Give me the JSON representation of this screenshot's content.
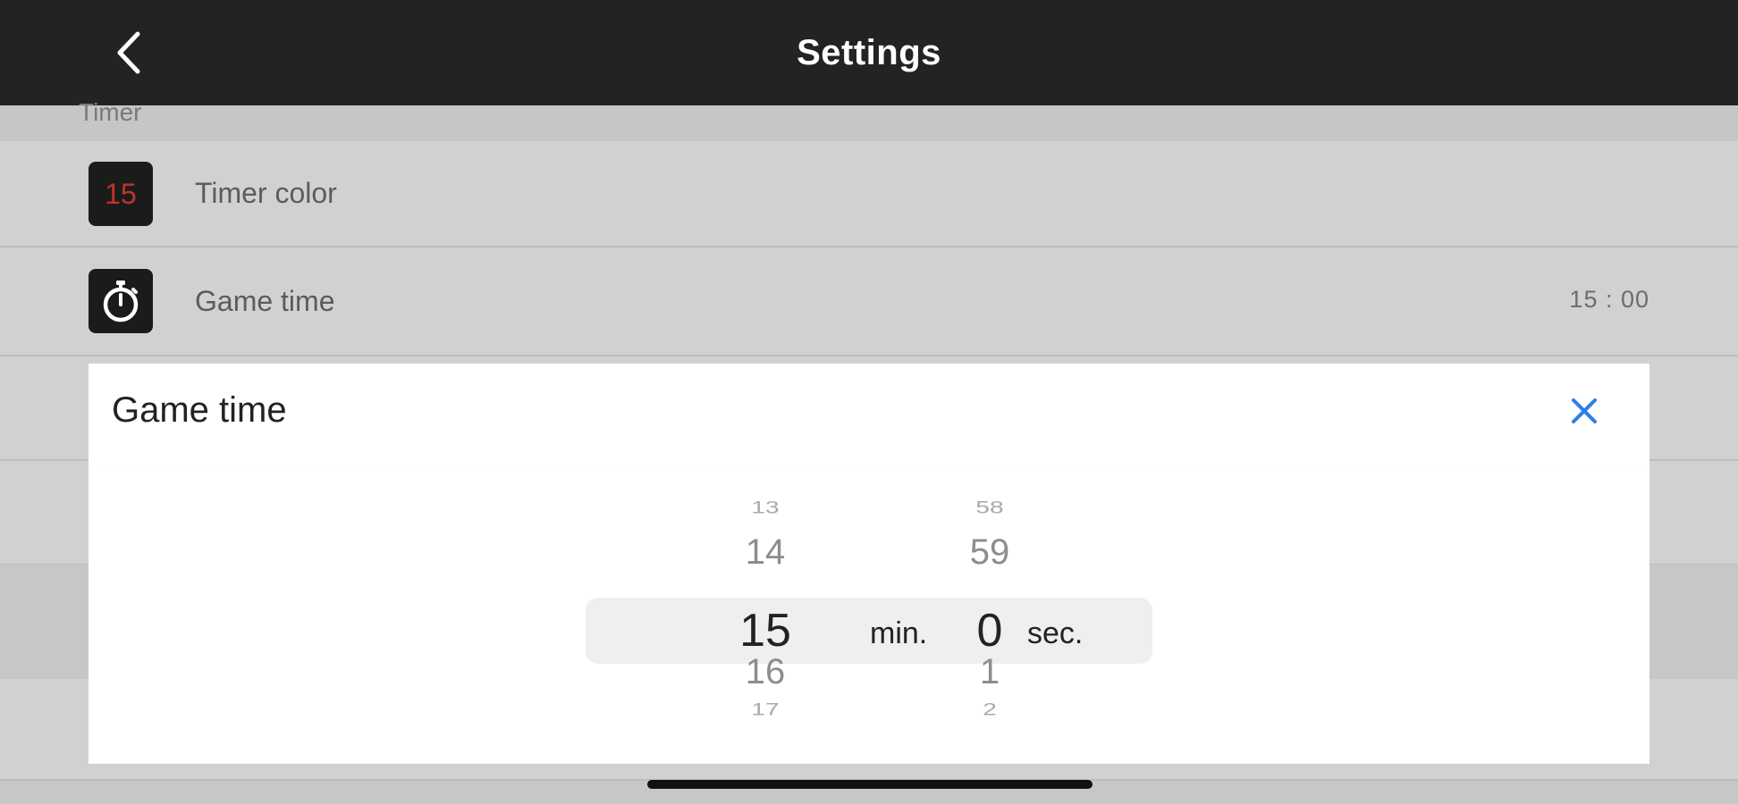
{
  "nav": {
    "title": "Settings"
  },
  "section": {
    "header": "Timer"
  },
  "rows": [
    {
      "icon": "timer-color-icon",
      "icon_text": "15",
      "label": "Timer color",
      "value": ""
    },
    {
      "icon": "stopwatch-icon",
      "label": "Game time",
      "value": "15 : 00"
    }
  ],
  "dialog": {
    "title": "Game time",
    "minutes": {
      "above_far": "13",
      "above": "14",
      "selected": "15",
      "below": "16",
      "below_far": "17",
      "unit": "min."
    },
    "seconds": {
      "above_far": "58",
      "above": "59",
      "selected": "0",
      "below": "1",
      "below_far": "2",
      "unit": "sec."
    }
  },
  "colors": {
    "accent": "#2f7fe6",
    "timer_digit": "#c0342b"
  }
}
